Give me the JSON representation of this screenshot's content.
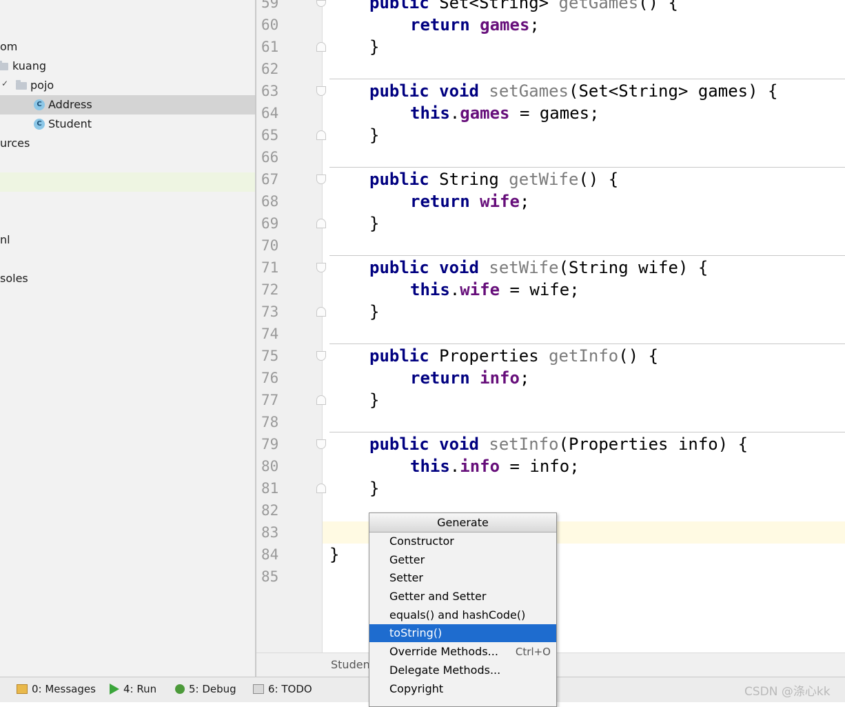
{
  "project_tree": {
    "items": [
      {
        "label": "om"
      },
      {
        "label": "kuang"
      },
      {
        "label": "pojo"
      },
      {
        "label": "Address",
        "icon": "C"
      },
      {
        "label": "Student",
        "icon": "C"
      },
      {
        "label": "urces"
      },
      {
        "label": "nl"
      },
      {
        "label": "soles"
      }
    ]
  },
  "editor": {
    "line_numbers": [
      "59",
      "60",
      "61",
      "62",
      "63",
      "64",
      "65",
      "66",
      "67",
      "68",
      "69",
      "70",
      "71",
      "72",
      "73",
      "74",
      "75",
      "76",
      "77",
      "78",
      "79",
      "80",
      "81",
      "82",
      "83",
      "84",
      "85"
    ],
    "code": {
      "l59": {
        "kw": "public",
        "t1": " Set<String> ",
        "m": "getGames",
        "t2": "() {"
      },
      "l60": {
        "kw": "return",
        "sp": " ",
        "f": "games",
        "t": ";"
      },
      "l61": {
        "t": "}"
      },
      "l63": {
        "kw": "public void",
        "sp": " ",
        "m": "setGames",
        "t": "(Set<String> games) {"
      },
      "l64": {
        "kw": "this",
        "dot": ".",
        "f": "games",
        "t": " = games;"
      },
      "l65": {
        "t": "}"
      },
      "l67": {
        "kw": "public",
        "t1": " String ",
        "m": "getWife",
        "t2": "() {"
      },
      "l68": {
        "kw": "return",
        "sp": " ",
        "f": "wife",
        "t": ";"
      },
      "l69": {
        "t": "}"
      },
      "l71": {
        "kw": "public void",
        "sp": " ",
        "m": "setWife",
        "t": "(String wife) {"
      },
      "l72": {
        "kw": "this",
        "dot": ".",
        "f": "wife",
        "t": " = wife;"
      },
      "l73": {
        "t": "}"
      },
      "l75": {
        "kw": "public",
        "t1": " Properties ",
        "m": "getInfo",
        "t2": "() {"
      },
      "l76": {
        "kw": "return",
        "sp": " ",
        "f": "info",
        "t": ";"
      },
      "l77": {
        "t": "}"
      },
      "l79": {
        "kw": "public void",
        "sp": " ",
        "m": "setInfo",
        "t": "(Properties info) {"
      },
      "l80": {
        "kw": "this",
        "dot": ".",
        "f": "info",
        "t": " = info;"
      },
      "l81": {
        "t": "}"
      },
      "l84": {
        "t": "}"
      }
    },
    "breadcrumb": "Studen"
  },
  "generate_popup": {
    "title": "Generate",
    "items": [
      {
        "label": "Constructor",
        "shortcut": ""
      },
      {
        "label": "Getter",
        "shortcut": ""
      },
      {
        "label": "Setter",
        "shortcut": ""
      },
      {
        "label": "Getter and Setter",
        "shortcut": ""
      },
      {
        "label": "equals() and hashCode()",
        "shortcut": ""
      },
      {
        "label": "toString()",
        "shortcut": "",
        "selected": true
      },
      {
        "label": "Override Methods...",
        "shortcut": "Ctrl+O"
      },
      {
        "label": "Delegate Methods...",
        "shortcut": ""
      },
      {
        "label": "Copyright",
        "shortcut": ""
      }
    ]
  },
  "bottom_toolbar": {
    "items": [
      {
        "label": "0: Messages",
        "icon": "messages-icon"
      },
      {
        "label": "4: Run",
        "icon": "run-icon"
      },
      {
        "label": "5: Debug",
        "icon": "debug-icon"
      },
      {
        "label": "6: TODO",
        "icon": "todo-icon"
      }
    ]
  },
  "watermark": "CSDN @涤心kk",
  "colors": {
    "keyword": "#000080",
    "field": "#660e7a",
    "method_declaration": "#7a7a7a",
    "selection": "#1e6ccf",
    "caret_line": "#fffae3"
  }
}
